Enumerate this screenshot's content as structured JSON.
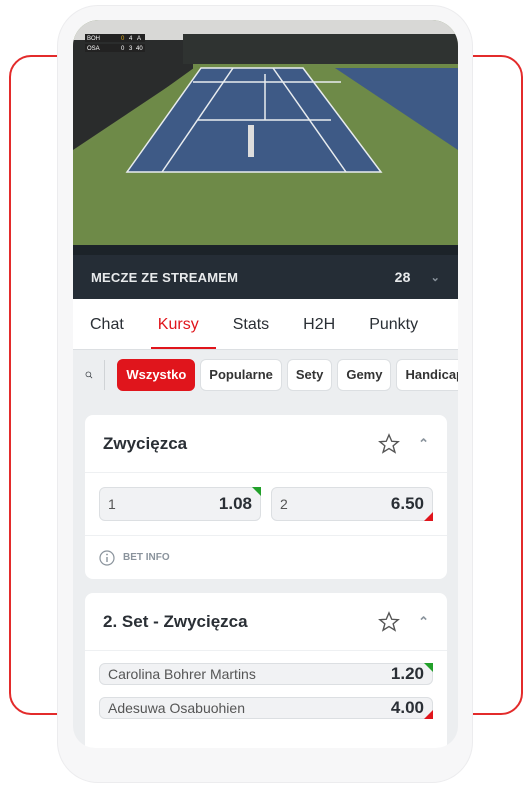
{
  "video": {
    "scoreboard": [
      {
        "team": "BOH",
        "sets": "0",
        "games": "4",
        "points": "A"
      },
      {
        "team": "OSA",
        "sets": "0",
        "games": "3",
        "points": "40"
      }
    ]
  },
  "header": {
    "title": "MECZE ZE STREAMEM",
    "count": "28",
    "chevron": "chevron-down-icon"
  },
  "tabs": [
    {
      "label": "Chat"
    },
    {
      "label": "Kursy",
      "active": true
    },
    {
      "label": "Stats"
    },
    {
      "label": "H2H"
    },
    {
      "label": "Punkty"
    }
  ],
  "filters": [
    {
      "label": "Wszystko",
      "active": true
    },
    {
      "label": "Popularne"
    },
    {
      "label": "Sety"
    },
    {
      "label": "Gemy"
    },
    {
      "label": "Handicap"
    }
  ],
  "markets": [
    {
      "title": "Zwycięzca",
      "odds": [
        {
          "label": "1",
          "value": "1.08",
          "trend": "up"
        },
        {
          "label": "2",
          "value": "6.50",
          "trend": "down"
        }
      ],
      "bet_info": "BET INFO"
    },
    {
      "title": "2. Set - Zwycięzca",
      "odds": [
        {
          "label": "Carolina Bohrer Martins",
          "value": "1.20",
          "trend": "up"
        },
        {
          "label": "Adesuwa Osabuohien",
          "value": "4.00",
          "trend": "down"
        }
      ]
    }
  ],
  "colors": {
    "accent": "#e0151c",
    "header_bg": "#252d36",
    "up": "#22a02a",
    "down": "#e0151c"
  }
}
